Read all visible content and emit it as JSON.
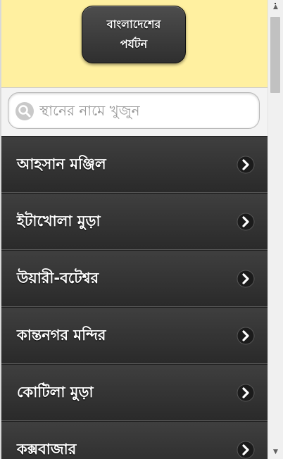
{
  "header": {
    "title_line1": "বাংলাদেশের",
    "title_line2": "পর্যটন"
  },
  "search": {
    "placeholder": "স্থানের নামে খুজুন",
    "value": ""
  },
  "places": [
    {
      "label": "আহসান মঞ্জিল",
      "icon": "chevron-right-icon"
    },
    {
      "label": "ইটাখোলা মুড়া",
      "icon": "chevron-right-icon"
    },
    {
      "label": "উয়ারী-বটেশ্বর",
      "icon": "chevron-right-icon"
    },
    {
      "label": "কান্তনগর মন্দির",
      "icon": "chevron-right-icon"
    },
    {
      "label": "কোটিলা মুড়া",
      "icon": "chevron-right-icon"
    },
    {
      "label": "কক্সবাজার",
      "icon": "chevron-right-icon"
    }
  ],
  "colors": {
    "header_bg": "#fff0a0",
    "list_bg": "#333333",
    "text": "#ffffff"
  }
}
